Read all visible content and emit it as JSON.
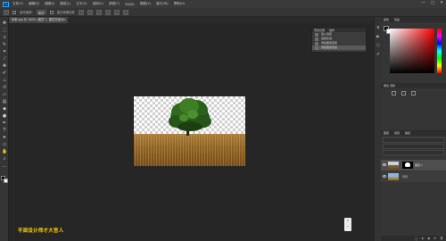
{
  "menubar": {
    "logo": "Ps",
    "items": [
      "文件(F)",
      "编辑(E)",
      "图像(I)",
      "图层(L)",
      "文字(Y)",
      "选择(S)",
      "滤镜(T)",
      "3D(D)",
      "视图(V)",
      "窗口(W)",
      "帮助(H)"
    ],
    "controls": {
      "minimize": "—",
      "maximize": "□",
      "close": "✕"
    }
  },
  "options": {
    "auto_select": "自动选择:",
    "layer_value": "图层",
    "show_transform": "显示变换控件"
  },
  "document": {
    "tab_title": "树素.jpg @ 100% (图层 1, 图层蒙版/8)",
    "close_glyph": "×"
  },
  "tools": [
    {
      "name": "move-tool-icon",
      "glyph": "✥"
    },
    {
      "name": "marquee-tool-icon",
      "glyph": "⬚"
    },
    {
      "name": "lasso-tool-icon",
      "glyph": "ↄ"
    },
    {
      "name": "quick-select-tool-icon",
      "glyph": "✎"
    },
    {
      "name": "crop-tool-icon",
      "glyph": "⌗"
    },
    {
      "name": "eyedropper-tool-icon",
      "glyph": "⁄"
    },
    {
      "name": "healing-brush-tool-icon",
      "glyph": "✚"
    },
    {
      "name": "brush-tool-icon",
      "glyph": "✐"
    },
    {
      "name": "clone-stamp-tool-icon",
      "glyph": "⊥"
    },
    {
      "name": "history-brush-tool-icon",
      "glyph": "↺"
    },
    {
      "name": "eraser-tool-icon",
      "glyph": "▱"
    },
    {
      "name": "gradient-tool-icon",
      "glyph": "▤"
    },
    {
      "name": "blur-tool-icon",
      "glyph": "◆"
    },
    {
      "name": "dodge-tool-icon",
      "glyph": "●"
    },
    {
      "name": "pen-tool-icon",
      "glyph": "✒"
    },
    {
      "name": "type-tool-icon",
      "glyph": "T"
    },
    {
      "name": "path-select-tool-icon",
      "glyph": "➤"
    },
    {
      "name": "shape-tool-icon",
      "glyph": "▭"
    },
    {
      "name": "hand-tool-icon",
      "glyph": "✋"
    },
    {
      "name": "zoom-tool-icon",
      "glyph": "⌕"
    },
    {
      "name": "more-tools-icon",
      "glyph": "…"
    }
  ],
  "history": {
    "tabs": [
      "历史记录",
      "动作"
    ],
    "items": [
      {
        "label": "载入选区",
        "active": false
      },
      {
        "label": "选择反向",
        "active": false
      },
      {
        "label": "添加图层蒙版",
        "active": false
      },
      {
        "label": "调整图层蒙版",
        "active": true
      }
    ],
    "footer_icons": [
      "snapshot-icon",
      "new-doc-icon",
      "trash-icon"
    ]
  },
  "dock_icons": [
    "history-panel-icon",
    "actions-panel-icon",
    "info-panel-icon",
    "brush-panel-icon"
  ],
  "color_panel": {
    "tabs": [
      "颜色",
      "色板"
    ],
    "foreground": "#000000",
    "background": "#ffffff"
  },
  "properties_panel": {
    "title": "属性  调整"
  },
  "layers_panel": {
    "tabs": [
      "图层",
      "通道",
      "路径"
    ],
    "layers": [
      {
        "name": "图层 1",
        "selected": true,
        "has_mask": true
      },
      {
        "name": "背景",
        "selected": false,
        "has_mask": false
      }
    ],
    "footer": [
      "ⓕ",
      "◐",
      "▣",
      "⊞",
      "🗑"
    ]
  },
  "watermark": "平面设计师才大官人",
  "zoom_control": {
    "plus": "+",
    "minus": "−"
  }
}
